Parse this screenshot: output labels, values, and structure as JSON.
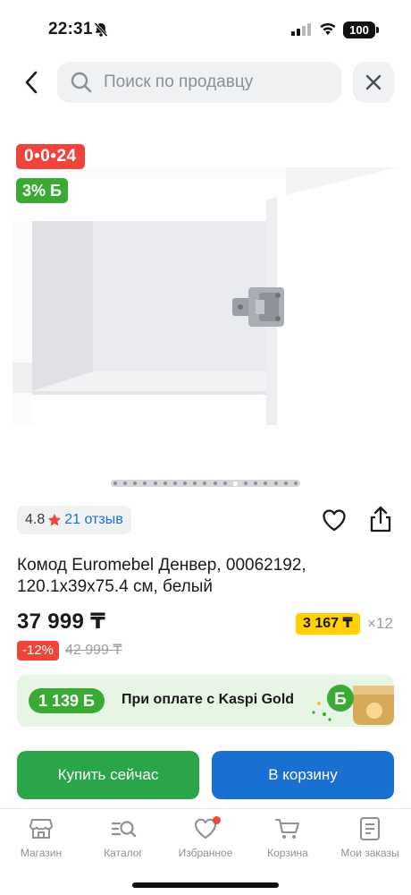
{
  "status_bar": {
    "time": "22:31",
    "battery": "100"
  },
  "search": {
    "placeholder": "Поиск по продавцу",
    "value": ""
  },
  "gallery": {
    "timer_badge": "0•0•24",
    "cashback_badge": "3% Б",
    "total_photos": 19,
    "active_photo_index": 12
  },
  "rating": {
    "value": "4.8",
    "reviews": "21 отзыв"
  },
  "product": {
    "title": "Комод Euromebel Денвер, 00062192, 120.1x39x75.4 см, белый"
  },
  "pricing": {
    "price": "37 999 ₸",
    "installment_price": "3 167 ₸",
    "installment_months": "×12",
    "discount": "-12%",
    "old_price": "42 999 ₸"
  },
  "kaspi_gold": {
    "bonus": "1 139 Б",
    "text": "При оплате с Kaspi Gold"
  },
  "actions": {
    "buy_now": "Купить сейчас",
    "to_cart": "В корзину"
  },
  "tabbar": {
    "items": [
      {
        "label": "Магазин",
        "icon": "shop-icon"
      },
      {
        "label": "Каталог",
        "icon": "catalog-icon"
      },
      {
        "label": "Избранное",
        "icon": "heart-icon"
      },
      {
        "label": "Корзина",
        "icon": "cart-icon"
      },
      {
        "label": "Мои заказы",
        "icon": "orders-icon"
      }
    ]
  },
  "colors": {
    "green": "#2aa54a",
    "blue": "#1a6fd2",
    "red": "#f0443a",
    "yellow": "#ffd200"
  }
}
